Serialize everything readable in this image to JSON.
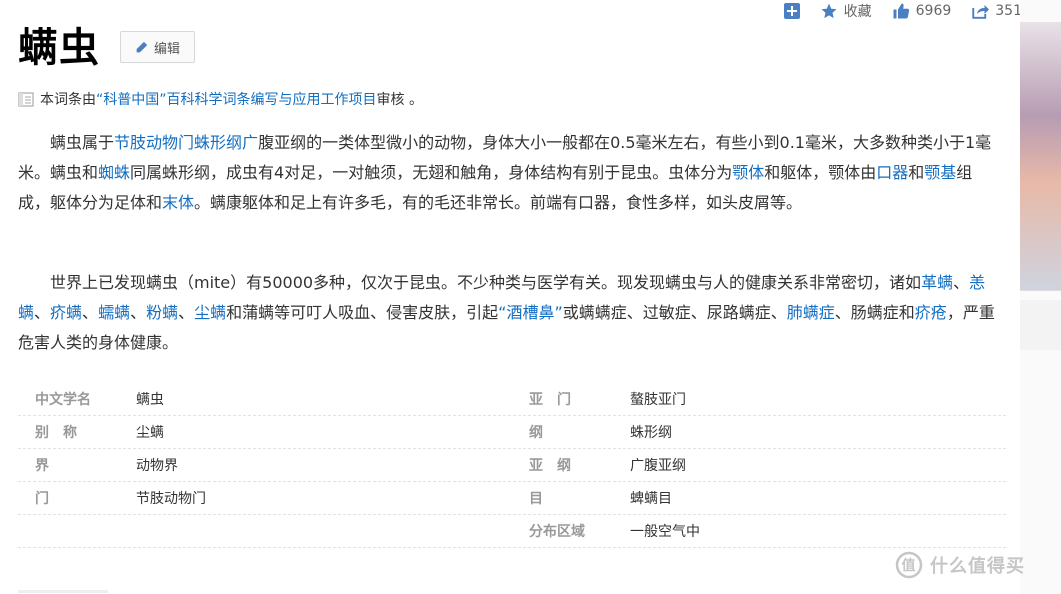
{
  "header": {
    "title": "螨虫",
    "edit_label": "编辑",
    "collect_label": "收藏",
    "like_count": "6969",
    "share_count": "351"
  },
  "review": {
    "prefix": "本词条由",
    "org": "“科普中国”百科科学词条编写与应用工作项目",
    "suffix": " 审核 。"
  },
  "paragraph1": [
    {
      "t": "螨虫属于",
      "link": false
    },
    {
      "t": "节肢动物门",
      "link": true
    },
    {
      "t": "蛛形纲",
      "link": true
    },
    {
      "t": "广",
      "link": true
    },
    {
      "t": "腹亚纲的一类体型微小的动物，身体大小一般都在0.5毫米左右，有些小到0.1毫米，大多数种类小于1毫米。螨虫和",
      "link": false
    },
    {
      "t": "蜘蛛",
      "link": true
    },
    {
      "t": "同属蛛形纲，成虫有4对足，一对触须，无翅和触角，身体结构有别于昆虫。虫体分为",
      "link": false
    },
    {
      "t": "颚体",
      "link": true
    },
    {
      "t": "和躯体，颚体由",
      "link": false
    },
    {
      "t": "口器",
      "link": true
    },
    {
      "t": "和",
      "link": false
    },
    {
      "t": "颚基",
      "link": true
    },
    {
      "t": "组成，躯体分为足体和",
      "link": false
    },
    {
      "t": "末体",
      "link": true
    },
    {
      "t": "。螨康躯体和足上有许多毛，有的毛还非常长。前端有口器，食性多样，如头皮屑等。",
      "link": false
    }
  ],
  "paragraph2": [
    {
      "t": "世界上已发现螨虫（mite）有50000多种，仅次于昆虫。不少种类与医学有关。现发现螨虫与人的健康关系非常密切，诸如",
      "link": false
    },
    {
      "t": "革螨",
      "link": true
    },
    {
      "t": "、",
      "link": false
    },
    {
      "t": "恙螨",
      "link": true
    },
    {
      "t": "、",
      "link": false
    },
    {
      "t": "疥螨",
      "link": true
    },
    {
      "t": "、",
      "link": false
    },
    {
      "t": "蠕螨",
      "link": true
    },
    {
      "t": "、",
      "link": false
    },
    {
      "t": "粉螨",
      "link": true
    },
    {
      "t": "、",
      "link": false
    },
    {
      "t": "尘螨",
      "link": true
    },
    {
      "t": "和蒲螨等可叮人吸血、侵害皮肤，引起",
      "link": false
    },
    {
      "t": "“酒槽鼻”",
      "link": true
    },
    {
      "t": "或螨螨症、过敏症、尿路螨症、",
      "link": false
    },
    {
      "t": "肺螨症",
      "link": true
    },
    {
      "t": "、肠螨症和",
      "link": false
    },
    {
      "t": "疥疮",
      "link": true
    },
    {
      "t": "，严重危害人类的身体健康。",
      "link": false
    }
  ],
  "infobox": {
    "rows": [
      {
        "l1": "中文学名",
        "v1": "螨虫",
        "l2": "亚　门",
        "v2": "螯肢亚门"
      },
      {
        "l1": "别　称",
        "v1": "尘螨",
        "l2": "纲",
        "v2": "蛛形纲"
      },
      {
        "l1": "界",
        "v1": "动物界",
        "l2": "亚　纲",
        "v2": "广腹亚纲"
      },
      {
        "l1": "门",
        "v1": "节肢动物门",
        "l2": "目",
        "v2": "蜱螨目"
      },
      {
        "l1": "",
        "v1": "",
        "l2": "分布区域",
        "v2": "一般空气中"
      }
    ]
  },
  "watermark": "什么值得买",
  "colors": {
    "link": "#136ec2",
    "label": "#999999",
    "text": "#333333"
  }
}
